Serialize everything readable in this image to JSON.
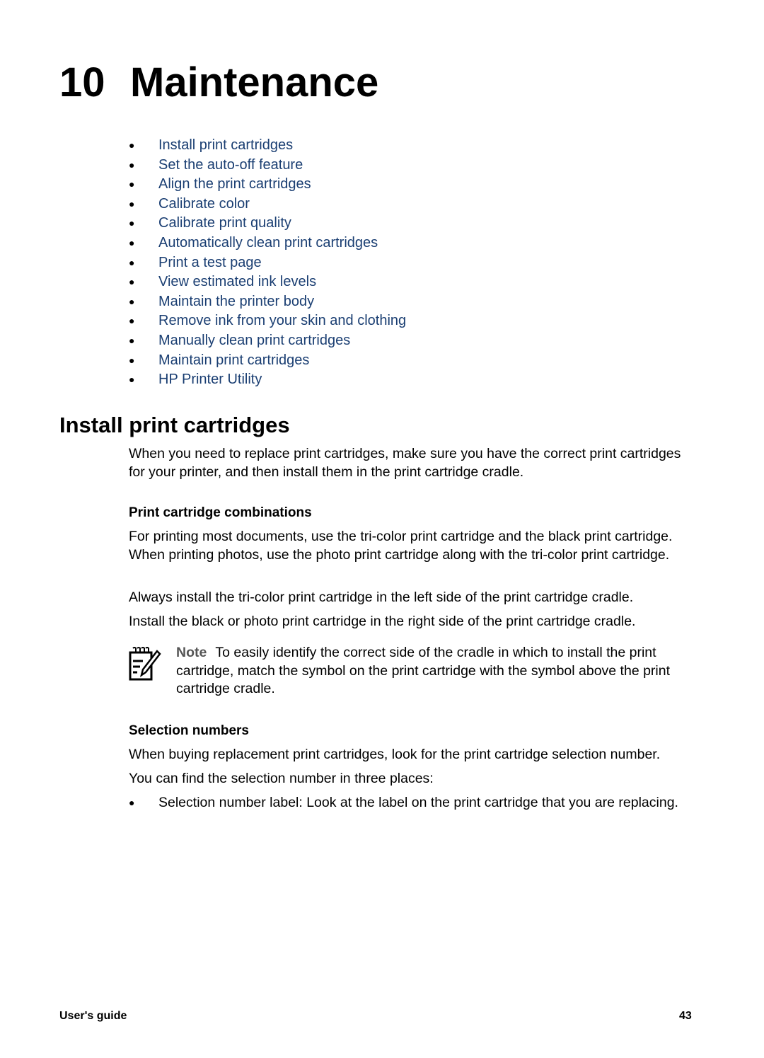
{
  "chapter": {
    "number": "10",
    "title": "Maintenance"
  },
  "toc": [
    "Install print cartridges",
    "Set the auto-off feature",
    "Align the print cartridges",
    "Calibrate color",
    "Calibrate print quality",
    "Automatically clean print cartridges",
    "Print a test page",
    "View estimated ink levels",
    "Maintain the printer body",
    "Remove ink from your skin and clothing",
    "Manually clean print cartridges",
    "Maintain print cartridges",
    "HP Printer Utility"
  ],
  "bullet_glyph": "●",
  "section": {
    "title": "Install print cartridges",
    "intro": "When you need to replace print cartridges, make sure you have the correct print cartridges for your printer, and then install them in the print cartridge cradle.",
    "combinations": {
      "heading": "Print cartridge combinations",
      "p1": "For printing most documents, use the tri-color print cartridge and the black print cartridge. When printing photos, use the photo print cartridge along with the tri-color print cartridge.",
      "p2": "Always install the tri-color print cartridge in the left side of the print cartridge cradle.",
      "p3": "Install the black or photo print cartridge in the right side of the print cartridge cradle."
    },
    "note": {
      "icon": "note-pencil-icon",
      "label": "Note",
      "text": "To easily identify the correct side of the cradle in which to install the print cartridge, match the symbol on the print cartridge with the symbol above the print cartridge cradle."
    },
    "selection": {
      "heading": "Selection numbers",
      "p1": "When buying replacement print cartridges, look for the print cartridge selection number.",
      "p2": "You can find the selection number in three places:",
      "bullets": [
        "Selection number label: Look at the label on the print cartridge that you are replacing."
      ]
    }
  },
  "footer": {
    "left": "User's guide",
    "page": "43"
  },
  "colors": {
    "link": "#1a3e72",
    "text": "#000000",
    "note_label": "#555555"
  }
}
